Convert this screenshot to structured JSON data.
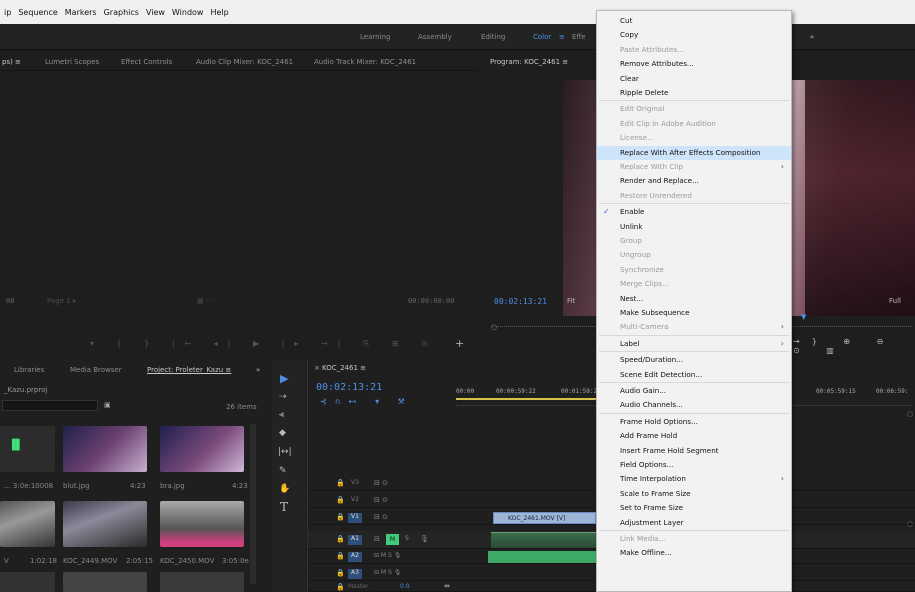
{
  "menubar": [
    "ip",
    "Sequence",
    "Markers",
    "Graphics",
    "View",
    "Window",
    "Help"
  ],
  "workspaces": {
    "learning": "Learning",
    "assembly": "Assembly",
    "editing": "Editing",
    "color": "Color",
    "effects": "Effe",
    "more": "»"
  },
  "source_panel": {
    "tabs": [
      "ps) ≡",
      "Lumetri Scopes",
      "Effect Controls",
      "Audio Clip Mixer: KOC_2461",
      "Audio Track Mixer: KOC_2461"
    ],
    "timecode_left": "00",
    "page_label": "Page 1",
    "timecode_right": "00:00:00:00"
  },
  "program_panel": {
    "title": "Program: KOC_2461  ≡",
    "timecode": "00:02:13:21",
    "fit": "Fit",
    "full": "Full"
  },
  "project_panel": {
    "tabs": [
      "Libraries",
      "Media Browser",
      "Project: Proleter_Kazu  ≡",
      "»"
    ],
    "file": "_Kazu.prproj",
    "item_count": "26 items",
    "thumbs": [
      {
        "name": "...",
        "dur": "3:0e:10008"
      },
      {
        "name": "blut.jpg",
        "dur": "4:23"
      },
      {
        "name": "bra.jpg",
        "dur": "4:23"
      },
      {
        "name": "V",
        "dur": "1:02:18"
      },
      {
        "name": "KOC_2449.MOV",
        "dur": "2:05:15"
      },
      {
        "name": "KOC_2450.MOV",
        "dur": "3:05:0e"
      }
    ]
  },
  "timeline": {
    "tab": "KOC_2461  ≡",
    "timecode": "00:02:13:21",
    "ruler": [
      "00:00",
      "00:00:59:22",
      "00:01:59:2",
      "00:05:59:15",
      "00:06:59:"
    ],
    "tracks": [
      "V3",
      "V2",
      "V1",
      "A1",
      "A2",
      "A3"
    ],
    "master_label": "Master",
    "master_value": "0.0",
    "clip_label": "KOC_2461.MOV [V]"
  },
  "context_menu": [
    {
      "label": "Cut",
      "enabled": true
    },
    {
      "label": "Copy",
      "enabled": true
    },
    {
      "label": "Paste Attributes...",
      "enabled": false
    },
    {
      "label": "Remove Attributes...",
      "enabled": true
    },
    {
      "label": "Clear",
      "enabled": true
    },
    {
      "label": "Ripple Delete",
      "enabled": true
    },
    {
      "sep": true
    },
    {
      "label": "Edit Original",
      "enabled": false
    },
    {
      "label": "Edit Clip In Adobe Audition",
      "enabled": false
    },
    {
      "label": "License...",
      "enabled": false
    },
    {
      "label": "Replace With After Effects Composition",
      "enabled": true,
      "selected": true
    },
    {
      "label": "Replace With Clip",
      "enabled": false,
      "submenu": true
    },
    {
      "label": "Render and Replace...",
      "enabled": true
    },
    {
      "label": "Restore Unrendered",
      "enabled": false
    },
    {
      "sep": true
    },
    {
      "label": "Enable",
      "enabled": true,
      "checked": true
    },
    {
      "label": "Unlink",
      "enabled": true
    },
    {
      "label": "Group",
      "enabled": false
    },
    {
      "label": "Ungroup",
      "enabled": false
    },
    {
      "label": "Synchronize",
      "enabled": false
    },
    {
      "label": "Merge Clips...",
      "enabled": false
    },
    {
      "label": "Nest...",
      "enabled": true
    },
    {
      "label": "Make Subsequence",
      "enabled": true
    },
    {
      "label": "Multi-Camera",
      "enabled": false,
      "submenu": true
    },
    {
      "sep": true
    },
    {
      "label": "Label",
      "enabled": true,
      "submenu": true
    },
    {
      "sep": true
    },
    {
      "label": "Speed/Duration...",
      "enabled": true
    },
    {
      "label": "Scene Edit Detection...",
      "enabled": true
    },
    {
      "sep": true
    },
    {
      "label": "Audio Gain...",
      "enabled": true
    },
    {
      "label": "Audio Channels...",
      "enabled": true
    },
    {
      "sep": true
    },
    {
      "label": "Frame Hold Options...",
      "enabled": true
    },
    {
      "label": "Add Frame Hold",
      "enabled": true
    },
    {
      "label": "Insert Frame Hold Segment",
      "enabled": true
    },
    {
      "label": "Field Options...",
      "enabled": true
    },
    {
      "label": "Time Interpolation",
      "enabled": true,
      "submenu": true
    },
    {
      "label": "Scale to Frame Size",
      "enabled": true
    },
    {
      "label": "Set to Frame Size",
      "enabled": true
    },
    {
      "label": "Adjustment Layer",
      "enabled": true
    },
    {
      "sep": true
    },
    {
      "label": "Link Media...",
      "enabled": false
    },
    {
      "label": "Make Offline...",
      "enabled": true
    }
  ]
}
